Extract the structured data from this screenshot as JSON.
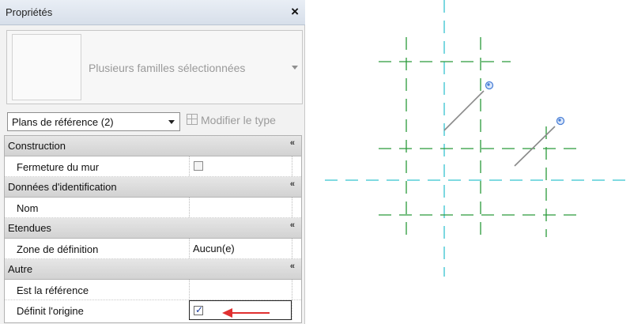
{
  "panel": {
    "title": "Propriétés",
    "close_glyph": "×",
    "preview": {
      "label": "Plusieurs familles sélectionnées"
    },
    "type_selector": {
      "value": "Plans de référence (2)"
    },
    "edit_type_label": "Modifier le type",
    "collapse_glyph": "«",
    "sections": [
      {
        "label": "Construction",
        "props": [
          {
            "label": "Fermeture du mur",
            "value": "",
            "checkbox": true,
            "checked": false
          }
        ]
      },
      {
        "label": "Données d'identification",
        "props": [
          {
            "label": "Nom",
            "value": ""
          }
        ]
      },
      {
        "label": "Etendues",
        "props": [
          {
            "label": "Zone de définition",
            "value": "Aucun(e)"
          }
        ]
      },
      {
        "label": "Autre",
        "props": [
          {
            "label": "Est la référence",
            "value": ""
          },
          {
            "label": "Définit l'origine",
            "value": "",
            "checkbox": true,
            "checked": true
          }
        ]
      }
    ]
  },
  "colors": {
    "reference_plane_dash": "#2a9a3a",
    "level_dash": "#35c3cf",
    "selected_line": "#8a8a8a",
    "handle": "#4a7fd6",
    "annotation_arrow": "#e03030"
  },
  "icons": {
    "close": "close-icon",
    "dropdown": "chevron-down-icon",
    "edit_type": "edit-type-icon",
    "collapse": "collapse-icon",
    "annotation": "red-arrow-icon"
  }
}
